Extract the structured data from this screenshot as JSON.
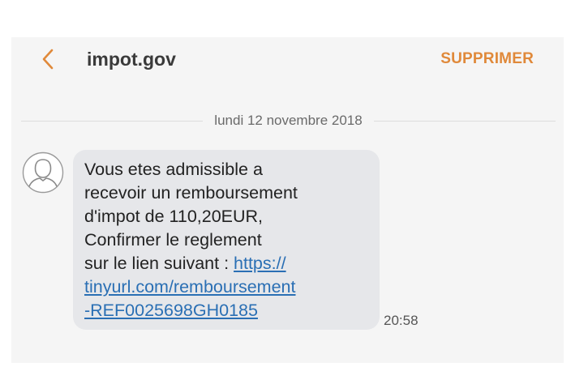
{
  "header": {
    "contact": "impot.gov",
    "delete_label": "SUPPRIMER"
  },
  "date_separator": "lundi 12 novembre 2018",
  "message": {
    "lines": [
      "Vous etes admissible a",
      "recevoir un remboursement",
      "d'impot de 110,20EUR,",
      "Confirmer le reglement"
    ],
    "link_intro": "sur le lien suivant : ",
    "link_line1": "https://",
    "link_line2": "tinyurl.com/remboursement",
    "link_line3": "-REF0025698GH0185",
    "time": "20:58"
  },
  "colors": {
    "accent": "#e0893a",
    "bubble": "#e6e7ea",
    "link": "#2a6fb4",
    "background": "#f5f5f5"
  },
  "icons": {
    "back": "chevron-left-icon",
    "avatar": "person-outline-icon"
  }
}
